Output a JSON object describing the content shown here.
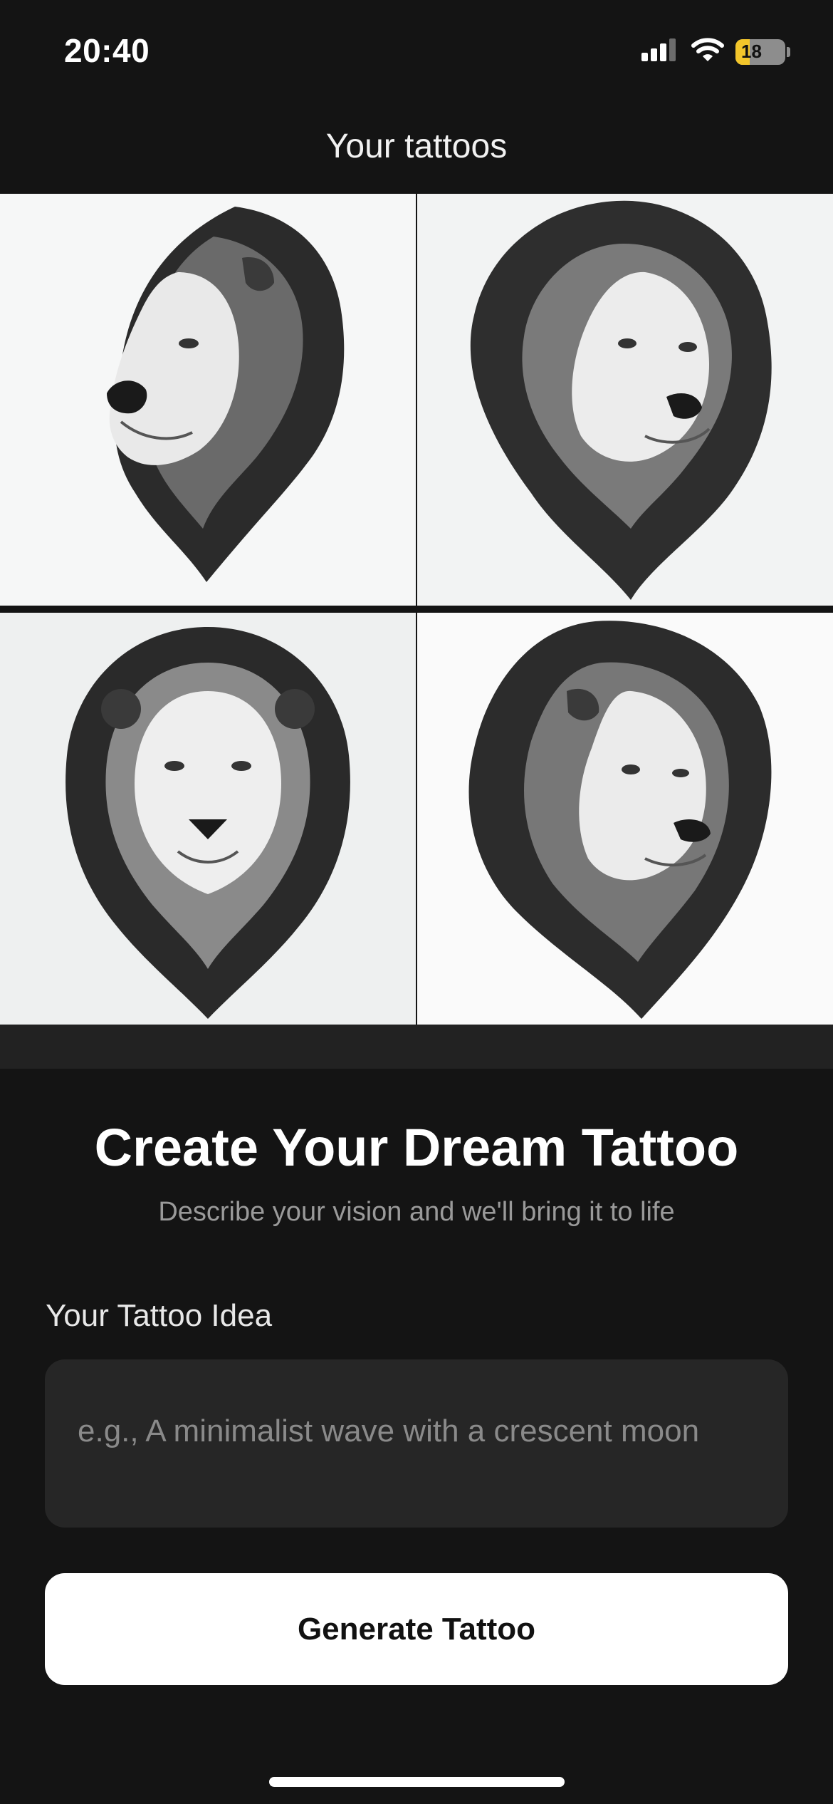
{
  "status_bar": {
    "time": "20:40",
    "battery": "18"
  },
  "header": {
    "title": "Your tattoos"
  },
  "gallery": {
    "images": [
      {
        "icon": "lion-head-profile-left"
      },
      {
        "icon": "lion-head-three-quarter"
      },
      {
        "icon": "lion-head-front"
      },
      {
        "icon": "lion-head-profile-right"
      }
    ]
  },
  "form": {
    "title": "Create Your Dream Tattoo",
    "subtitle": "Describe your vision and we'll bring it to life",
    "idea_label": "Your Tattoo Idea",
    "idea_placeholder": "e.g., A minimalist wave with a crescent moon",
    "generate_label": "Generate Tattoo"
  },
  "colors": {
    "background": "#141414",
    "input_background": "#262626",
    "button_background": "#ffffff",
    "battery_fill": "#f3c62b"
  }
}
